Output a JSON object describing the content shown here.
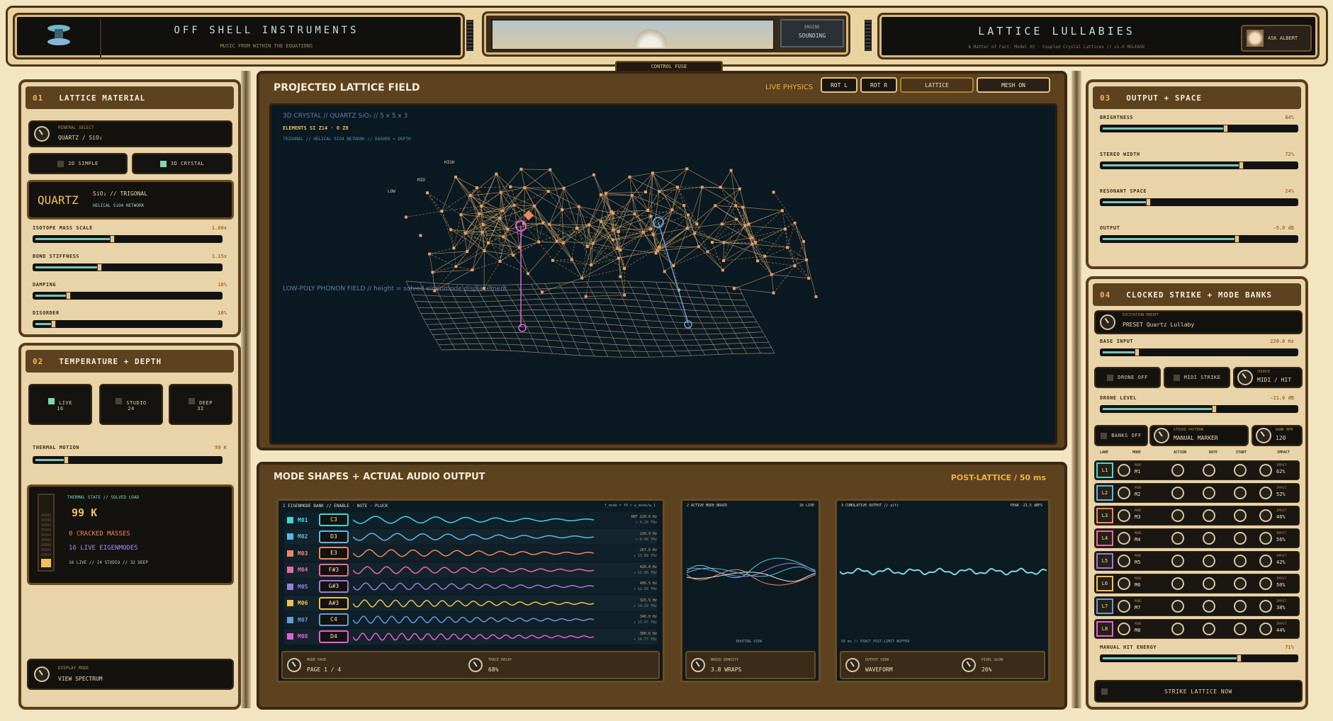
{
  "header": {
    "brand_title": "OFF SHELL INSTRUMENTS",
    "brand_subtitle": "MUSIC FROM WITHIN THE EQUATIONS",
    "status_label": "ENGINE",
    "status_value": "SOUNDING",
    "control_fuse": "CONTROL FUSE",
    "app_title": "LATTICE LULLABIES",
    "app_subtitle": "A Matter of Fact: Model 03 · Coupled Crystal Lattices // v1.0 RELEASE",
    "ask_button": "ASK ALBERT"
  },
  "lattice_material": {
    "num": "01",
    "title": "LATTICE MATERIAL",
    "mineral_label": "MINERAL SELECT",
    "mineral_value": "QUARTZ / SiO₂",
    "mode_2d": "2D SIMPLE",
    "mode_3d": "3D CRYSTAL",
    "crystal_name": "QUARTZ",
    "crystal_formula": "SiO₂ // TRIGONAL",
    "crystal_network": "HELICAL SiO4 NETWORK",
    "sliders": [
      {
        "label": "ISOTOPE MASS SCALE",
        "value": "1.00x",
        "level": 0.42
      },
      {
        "label": "BOND STIFFNESS",
        "value": "1.15x",
        "level": 0.35
      },
      {
        "label": "DAMPING",
        "value": "18%",
        "level": 0.18
      },
      {
        "label": "DISORDER",
        "value": "10%",
        "level": 0.1
      }
    ]
  },
  "temperature": {
    "num": "02",
    "title": "TEMPERATURE + DEPTH",
    "presets": [
      {
        "name": "LIVE",
        "val": "16"
      },
      {
        "name": "STUDIO",
        "val": "24"
      },
      {
        "name": "DEEP",
        "val": "32"
      }
    ],
    "thermal_label": "THERMAL MOTION",
    "thermal_value": "99 K",
    "thermal_level": 0.17,
    "state_title": "THERMAL STATE // SOLVED LOAD",
    "state_temp": "99 K",
    "state_cracked": "0 CRACKED MASSES",
    "state_eigen": "16 LIVE EIGENMODES",
    "state_depths": "16 LIVE // 24 STUDIO // 32 DEEP",
    "display_label": "DISPLAY MODE",
    "display_value": "VIEW SPECTRUM"
  },
  "field": {
    "title": "PROJECTED LATTICE FIELD",
    "live": "LIVE PHYSICS",
    "buttons": [
      "ROT L",
      "ROT R",
      "LATTICE",
      "MESH ON"
    ],
    "info1": "3D CRYSTAL // QUARTZ  SiO₂  // 5 x 5 x 3",
    "info2": "ELEMENTS  SI Z14 · O Z8",
    "info3": "TRIGONAL // HELICAL SIO4 NETWORK // DASHED = DEPTH",
    "phonon": "LOW-POLY PHONON FIELD // height = solved eigenmode displacement",
    "layers": [
      "HIGH",
      "MID",
      "LOW"
    ]
  },
  "modes": {
    "title": "MODE SHAPES + ACTUAL AUDIO OUTPUT",
    "post": "POST-LATTICE / 50 ms",
    "bank_title": "1  EIGENMODE BANK // ENABLE · NOTE · PLUCK",
    "bank_formula": "f_mode = f0 × ω_mode/ω_1",
    "rows": [
      {
        "id": "M01",
        "note": "C3",
        "freq": "REF 220.0 Hz",
        "thz": "≈ 6.26 THz",
        "color": "#46d4d9"
      },
      {
        "id": "M02",
        "note": "D3",
        "freq": "220.9 Hz",
        "thz": "≈ 6.46 THz",
        "color": "#5ab8e8"
      },
      {
        "id": "M03",
        "note": "E3",
        "freq": "267.6 Hz",
        "thz": "≈ 13.68 THz",
        "color": "#f0885a"
      },
      {
        "id": "M04",
        "note": "F#3",
        "freq": "420.0 Hz",
        "thz": "≈ 12.06 THz",
        "color": "#e86aa6"
      },
      {
        "id": "M05",
        "note": "G#3",
        "freq": "400.5 Hz",
        "thz": "≈ 12.56 THz",
        "color": "#9c7ad8"
      },
      {
        "id": "M06",
        "note": "A#3",
        "freq": "325.5 Hz",
        "thz": "≈ 14.29 THz",
        "color": "#f0c050"
      },
      {
        "id": "M07",
        "note": "C4",
        "freq": "340.0 Hz",
        "thz": "≈ 13.97 THz",
        "color": "#6a9ad8"
      },
      {
        "id": "M08",
        "note": "D4",
        "freq": "380.0 Hz",
        "thz": "≈ 14.77 THz",
        "color": "#e060d8"
      }
    ],
    "mode_page_label": "MODE PAGE",
    "mode_page_value": "PAGE 1 / 4",
    "trace_label": "TRACE DECAY",
    "trace_value": "68%",
    "braid_title": "2  ACTIVE MODE BRAID",
    "braid_live": "16 LIVE",
    "braid_caption": "ROUTING VIEW",
    "braid_label": "BRAID DENSITY",
    "braid_value": "3.8 WRAPS",
    "out_title": "3  CUMULATIVE OUTPUT // y(t)",
    "out_peak": "PEAK -21.5 dBFS",
    "out_caption": "50 ms // EXACT POST-LIMIT BUFFER",
    "view_label": "OUTPUT VIEW",
    "view_value": "WAVEFORM",
    "glow_label": "PIXEL GLOW",
    "glow_value": "26%"
  },
  "output": {
    "num": "03",
    "title": "OUTPUT + SPACE",
    "sliders": [
      {
        "label": "BRIGHTNESS",
        "value": "64%",
        "level": 0.64
      },
      {
        "label": "STEREO WIDTH",
        "value": "72%",
        "level": 0.72
      },
      {
        "label": "RESONANT SPACE",
        "value": "24%",
        "level": 0.24
      },
      {
        "label": "OUTPUT",
        "value": "-5.0 dB",
        "level": 0.7
      }
    ]
  },
  "strike": {
    "num": "04",
    "title": "CLOCKED STRIKE + MODE BANKS",
    "preset_label": "EXCITATION PRESET",
    "preset_value": "PRESET  Quartz Lullaby",
    "base_label": "BASE INPUT",
    "base_value": "220.0 Hz",
    "base_level": 0.18,
    "drone_off": "DRONE OFF",
    "midi_strike": "MIDI STRIKE",
    "source_label": "SOURCE",
    "source_value": "MIDI / HIT",
    "drone_label": "DRONE LEVEL",
    "drone_value": "-21.0 dB",
    "drone_level": 0.58,
    "banks_off": "BANKS OFF",
    "pattern_label": "STRIKE PATTERN",
    "pattern_value": "MANUAL MARKER",
    "bpm_label": "BANK BPM",
    "bpm_value": "120",
    "cols": [
      "LANE",
      "MODE",
      "ACTION",
      "RATE",
      "START",
      "IMPACT"
    ],
    "lanes": [
      {
        "lane": "L1",
        "mode": "M1",
        "impact": "62%",
        "color": "#46d4d9"
      },
      {
        "lane": "L2",
        "mode": "M2",
        "impact": "52%",
        "color": "#5ab8e8"
      },
      {
        "lane": "L3",
        "mode": "M3",
        "impact": "46%",
        "color": "#f0885a"
      },
      {
        "lane": "L4",
        "mode": "M4",
        "impact": "56%",
        "color": "#e86aa6"
      },
      {
        "lane": "L5",
        "mode": "M5",
        "impact": "42%",
        "color": "#9c7ad8"
      },
      {
        "lane": "L6",
        "mode": "M6",
        "impact": "50%",
        "color": "#f0c050"
      },
      {
        "lane": "L7",
        "mode": "M7",
        "impact": "38%",
        "color": "#6a9ad8"
      },
      {
        "lane": "L8",
        "mode": "M8",
        "impact": "44%",
        "color": "#e060d8"
      }
    ],
    "lane_mode_label": "MODE",
    "lane_impact_label": "IMPACT",
    "hit_label": "MANUAL HIT ENERGY",
    "hit_value": "71%",
    "hit_level": 0.71,
    "strike_now": "STRIKE LATTICE NOW"
  }
}
